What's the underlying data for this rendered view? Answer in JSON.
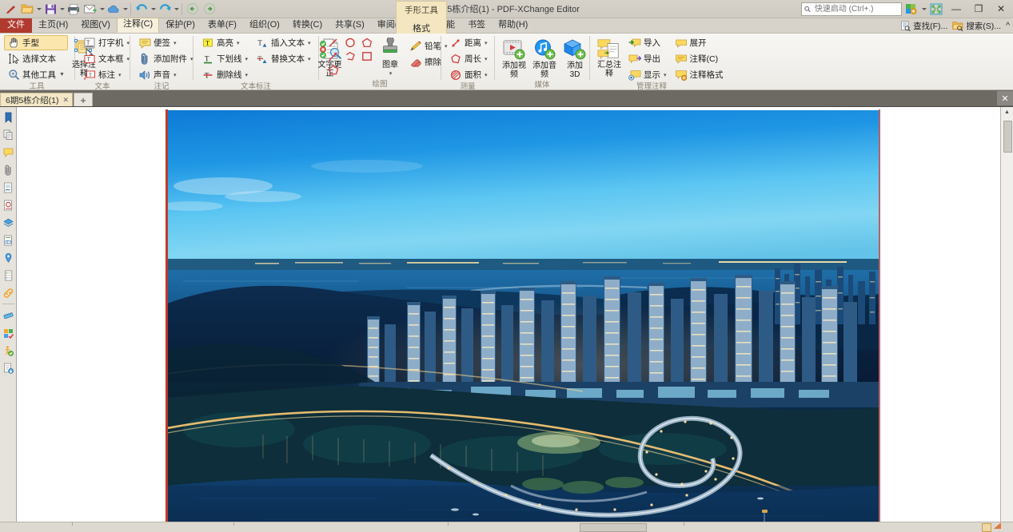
{
  "window": {
    "title": "6期5栋介绍(1) - PDF-XChange Editor",
    "minimize": "—",
    "maximize": "❐",
    "close": "✕"
  },
  "quick_access": {
    "items": [
      {
        "name": "app-logo",
        "label": ""
      },
      {
        "name": "open-file",
        "label": "打开"
      },
      {
        "name": "save",
        "label": "保存"
      },
      {
        "name": "print",
        "label": "打印"
      },
      {
        "name": "email",
        "label": "邮件"
      },
      {
        "name": "cloud",
        "label": "云"
      },
      {
        "name": "undo",
        "label": "撤销"
      },
      {
        "name": "redo",
        "label": "重做"
      },
      {
        "name": "previous-view",
        "label": "上一视图"
      },
      {
        "name": "next-view",
        "label": "下一视图"
      }
    ]
  },
  "search": {
    "placeholder": "快速启动 (Ctrl+.)",
    "value": ""
  },
  "menu_tabs": [
    {
      "label": "文件",
      "type": "file"
    },
    {
      "label": "主页(H)",
      "type": "tab"
    },
    {
      "label": "视图(V)",
      "type": "tab"
    },
    {
      "label": "注释(C)",
      "type": "tab",
      "active": true
    },
    {
      "label": "保护(P)",
      "type": "tab"
    },
    {
      "label": "表单(F)",
      "type": "tab"
    },
    {
      "label": "组织(O)",
      "type": "tab"
    },
    {
      "label": "转换(C)",
      "type": "tab"
    },
    {
      "label": "共享(S)",
      "type": "tab"
    },
    {
      "label": "审阅(R)",
      "type": "tab"
    },
    {
      "label": "辅助功能",
      "type": "tab"
    },
    {
      "label": "书签",
      "type": "tab"
    },
    {
      "label": "帮助(H)",
      "type": "tab"
    }
  ],
  "contextual_group": {
    "title": "手形工具",
    "subtitle": "格式"
  },
  "tabrow_right": [
    {
      "label": "查找(F)...",
      "icon": "find-icon"
    },
    {
      "label": "搜索(S)...",
      "icon": "search-folder-icon"
    },
    {
      "label": "^",
      "icon": "collapse-ribbon-icon"
    }
  ],
  "ribbon": {
    "groups": [
      {
        "label": "工具",
        "items": [
          {
            "label": "手型",
            "icon": "hand-tool-icon",
            "kind": "small",
            "selected": true
          },
          {
            "label": "选择文本",
            "icon": "select-text-icon",
            "kind": "small"
          },
          {
            "label": "其他工具",
            "icon": "other-tools-icon",
            "kind": "small",
            "dropdown": true
          },
          {
            "label": "选择注释",
            "icon": "select-annotation-icon",
            "kind": "big"
          }
        ]
      },
      {
        "label": "文本",
        "items": [
          {
            "label": "打字机",
            "icon": "typewriter-icon",
            "kind": "small",
            "dropdown": true
          },
          {
            "label": "文本框",
            "icon": "text-box-icon",
            "kind": "small",
            "dropdown": true
          },
          {
            "label": "标注",
            "icon": "callout-icon",
            "kind": "small",
            "dropdown": true
          }
        ]
      },
      {
        "label": "注记",
        "items": [
          {
            "label": "便签",
            "icon": "sticky-note-icon",
            "kind": "small",
            "dropdown": true
          },
          {
            "label": "添加附件",
            "icon": "attachment-icon",
            "kind": "small",
            "dropdown": true
          },
          {
            "label": "声音",
            "icon": "sound-icon",
            "kind": "small",
            "dropdown": true
          }
        ]
      },
      {
        "label": "文本标注",
        "items": [
          {
            "label": "高亮",
            "icon": "highlight-icon",
            "kind": "small",
            "dropdown": true
          },
          {
            "label": "下划线",
            "icon": "underline-icon",
            "kind": "small",
            "dropdown": true
          },
          {
            "label": "删除线",
            "icon": "strikeout-icon",
            "kind": "small",
            "dropdown": true
          },
          {
            "label": "插入文本",
            "icon": "insert-text-icon",
            "kind": "small",
            "dropdown": true
          },
          {
            "label": "替换文本",
            "icon": "replace-text-icon",
            "kind": "small",
            "dropdown": true
          },
          {
            "label": "文字更正",
            "icon": "text-correction-icon",
            "kind": "big"
          }
        ]
      },
      {
        "label": "绘图",
        "items": [
          {
            "label": "直线",
            "icon": "line-shape-icon",
            "kind": "shape"
          },
          {
            "label": "椭圆",
            "icon": "ellipse-shape-icon",
            "kind": "shape"
          },
          {
            "label": "多边形",
            "icon": "polygon-shape-icon",
            "kind": "shape"
          },
          {
            "label": "箭头",
            "icon": "arrow-shape-icon",
            "kind": "shape"
          },
          {
            "label": "折线",
            "icon": "polyline-shape-icon",
            "kind": "shape"
          },
          {
            "label": "矩形",
            "icon": "rectangle-shape-icon",
            "kind": "shape"
          },
          {
            "label": "五边形",
            "icon": "pentagon-shape-icon",
            "kind": "shape"
          },
          {
            "label": "图章",
            "icon": "stamp-icon",
            "kind": "big",
            "dropdown": true
          },
          {
            "label": "铅笔",
            "icon": "pencil-icon",
            "kind": "small",
            "dropdown": true
          },
          {
            "label": "擦除",
            "icon": "eraser-icon",
            "kind": "small"
          }
        ]
      },
      {
        "label": "测量",
        "items": [
          {
            "label": "距离",
            "icon": "distance-icon",
            "kind": "small",
            "dropdown": true
          },
          {
            "label": "周长",
            "icon": "perimeter-icon",
            "kind": "small",
            "dropdown": true
          },
          {
            "label": "面积",
            "icon": "area-icon",
            "kind": "small",
            "dropdown": true
          }
        ]
      },
      {
        "label": "媒体",
        "items": [
          {
            "label": "添加视频",
            "icon": "add-video-icon",
            "kind": "big"
          },
          {
            "label": "添加音频",
            "icon": "add-audio-icon",
            "kind": "big"
          },
          {
            "label": "添加 3D",
            "icon": "add-3d-icon",
            "kind": "big"
          }
        ]
      },
      {
        "label": "管理注释",
        "items": [
          {
            "label": "汇总注释",
            "icon": "summarize-comments-icon",
            "kind": "big"
          },
          {
            "label": "导入",
            "icon": "import-icon",
            "kind": "small"
          },
          {
            "label": "导出",
            "icon": "export-icon",
            "kind": "small"
          },
          {
            "label": "显示",
            "icon": "show-icon",
            "kind": "small",
            "dropdown": true
          },
          {
            "label": "展开",
            "icon": "expand-icon",
            "kind": "small"
          },
          {
            "label": "注释(C)",
            "icon": "comments-pane-icon",
            "kind": "small"
          },
          {
            "label": "注释格式",
            "icon": "comment-format-icon",
            "kind": "small"
          }
        ]
      }
    ]
  },
  "document_tabs": {
    "tabs": [
      {
        "label": "6期5栋介绍(1)",
        "close": "✕",
        "active": true
      }
    ],
    "new_tab": "+",
    "close_all": "✕"
  },
  "nav_pane": {
    "icons": [
      {
        "name": "bookmarks-icon"
      },
      {
        "name": "thumbnails-icon"
      },
      {
        "name": "comments-icon"
      },
      {
        "name": "attachments-icon"
      },
      {
        "name": "signatures-icon"
      },
      {
        "name": "stamps-icon"
      },
      {
        "name": "layers-icon"
      },
      {
        "name": "fields-icon"
      },
      {
        "name": "destinations-icon"
      },
      {
        "name": "content-icon"
      },
      {
        "name": "links-icon"
      },
      {
        "name": "measure-pane-icon"
      },
      {
        "name": "spell-check-icon"
      },
      {
        "name": "accessibility-icon"
      },
      {
        "name": "export-pane-icon"
      }
    ]
  },
  "page_view": {
    "image_alt": "aerial night cityscape with waterfront high-rises and curved pier",
    "annotation": {
      "type": "red-line",
      "color": "#c0392b"
    },
    "colors": {
      "sky_top": "#0a7fd4",
      "sky_mid": "#4fc4f2",
      "water_deep": "#0d2c52",
      "water_mid": "#14467a",
      "hills": "#0b2240",
      "lights": "#ffd488"
    }
  },
  "scrollbars": {
    "vertical": {
      "up": "▲",
      "down": "▼"
    },
    "horizontal": {}
  }
}
